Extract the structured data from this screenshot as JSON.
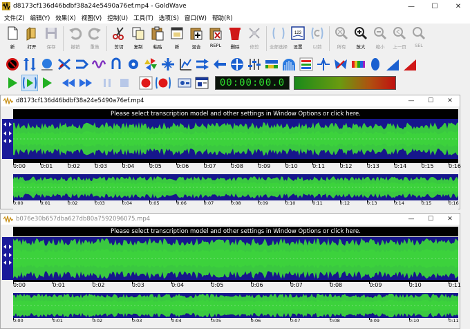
{
  "window": {
    "title": "d8173cf136d46bdbf38a24e5490a76ef.mp4 - GoldWave",
    "min": "—",
    "max": "☐",
    "close": "✕"
  },
  "menu": [
    "文件(Z)",
    "编辑(Y)",
    "效果(X)",
    "视图(V)",
    "控制(U)",
    "工具(T)",
    "选项(S)",
    "窗口(W)",
    "帮助(R)"
  ],
  "toolbar": [
    {
      "name": "new",
      "label": "新",
      "icon": "new-file-icon",
      "enabled": true
    },
    {
      "name": "open",
      "label": "打开",
      "icon": "open-folder-icon",
      "enabled": true
    },
    {
      "name": "save",
      "label": "保存",
      "icon": "save-icon",
      "enabled": false
    },
    {
      "name": "undo",
      "label": "撤销",
      "icon": "undo-icon",
      "enabled": false
    },
    {
      "name": "redo",
      "label": "重做",
      "icon": "redo-icon",
      "enabled": false
    },
    {
      "name": "cut",
      "label": "剪切",
      "icon": "scissors-icon",
      "enabled": true
    },
    {
      "name": "copy",
      "label": "复制",
      "icon": "copy-icon",
      "enabled": true
    },
    {
      "name": "paste",
      "label": "粘贴",
      "icon": "paste-icon",
      "enabled": true
    },
    {
      "name": "paste-new",
      "label": "新",
      "icon": "paste-new-icon",
      "enabled": true
    },
    {
      "name": "mix",
      "label": "混合",
      "icon": "mix-icon",
      "enabled": true
    },
    {
      "name": "replace",
      "label": "REPL",
      "icon": "replace-icon",
      "enabled": true
    },
    {
      "name": "delete",
      "label": "删除",
      "icon": "trash-icon",
      "enabled": true
    },
    {
      "name": "trim",
      "label": "修剪",
      "icon": "trim-icon",
      "enabled": false
    },
    {
      "name": "select-all",
      "label": "全部选择",
      "icon": "select-all-icon",
      "enabled": false
    },
    {
      "name": "set",
      "label": "设置",
      "icon": "set-marker-icon",
      "enabled": true
    },
    {
      "name": "previous",
      "label": "以前",
      "icon": "previous-icon",
      "enabled": false
    },
    {
      "name": "zoom-all",
      "label": "所有",
      "icon": "zoom-all-icon",
      "enabled": false
    },
    {
      "name": "zoom-in",
      "label": "放大",
      "icon": "zoom-in-icon",
      "enabled": true
    },
    {
      "name": "zoom-out",
      "label": "缩小",
      "icon": "zoom-out-icon",
      "enabled": false
    },
    {
      "name": "prev-page",
      "label": "上一页",
      "icon": "prev-page-icon",
      "enabled": false
    },
    {
      "name": "zoom-sel",
      "label": "SEL",
      "icon": "zoom-selection-icon",
      "enabled": false
    }
  ],
  "effects_bar": [
    "stop-sign-icon",
    "resample-icon",
    "ball-icon",
    "swap-channels-icon",
    "filter-icon",
    "wave-icon",
    "loop-icon",
    "gear-icon",
    "pinwheel-icon",
    "expand-icon",
    "equalizer-icon",
    "arrows-right-icon",
    "arrow-left-icon",
    "crosshair-icon",
    "mixer-icon",
    "volume-icon",
    "spectrum-icon",
    "chart-icon",
    "spike-icon",
    "butterfly-icon",
    "color-bar-icon",
    "speaker-icon",
    "volume-shape-icon",
    "volume-up-icon"
  ],
  "transport": {
    "time": "00:00:00.0"
  },
  "documents": [
    {
      "title": "d8173cf136d46bdbf38a24e5490a76ef.mp4",
      "active": true,
      "banner": "Please select transcription model and other settings in Window Options or click here.",
      "ruler": [
        "0:00",
        "0:01",
        "0:02",
        "0:03",
        "0:04",
        "0:05",
        "0:06",
        "0:07",
        "0:08",
        "0:09",
        "0:10",
        "0:11",
        "0:12",
        "0:13",
        "0:14",
        "0:15",
        "0:16"
      ],
      "overview_ruler": [
        "0:00",
        "0:01",
        "0:02",
        "0:03",
        "0:04",
        "0:05",
        "0:06",
        "0:07",
        "0:08",
        "0:09",
        "0:10",
        "0:11",
        "0:12",
        "0:13",
        "0:14",
        "0:15",
        "0:16"
      ]
    },
    {
      "title": "b076e30b657dba627db80a7592096075.mp4",
      "active": false,
      "banner": "Please select transcription model and other settings in Window Options or click here.",
      "ruler": [
        "0:00",
        "0:01",
        "0:02",
        "0:03",
        "0:04",
        "0:05",
        "0:06",
        "0:07",
        "0:08",
        "0:09",
        "0:10",
        "0:11"
      ],
      "overview_ruler": [
        "0:00",
        "0:01",
        "0:02",
        "0:03",
        "0:04",
        "0:05",
        "0:06",
        "0:07",
        "0:08",
        "0:09",
        "0:10",
        "0:11"
      ]
    }
  ],
  "colors": {
    "wave_green": "#3cd23c",
    "wave_blue": "#16168c",
    "background": "#000000",
    "clock_green": "#2fe02f"
  }
}
